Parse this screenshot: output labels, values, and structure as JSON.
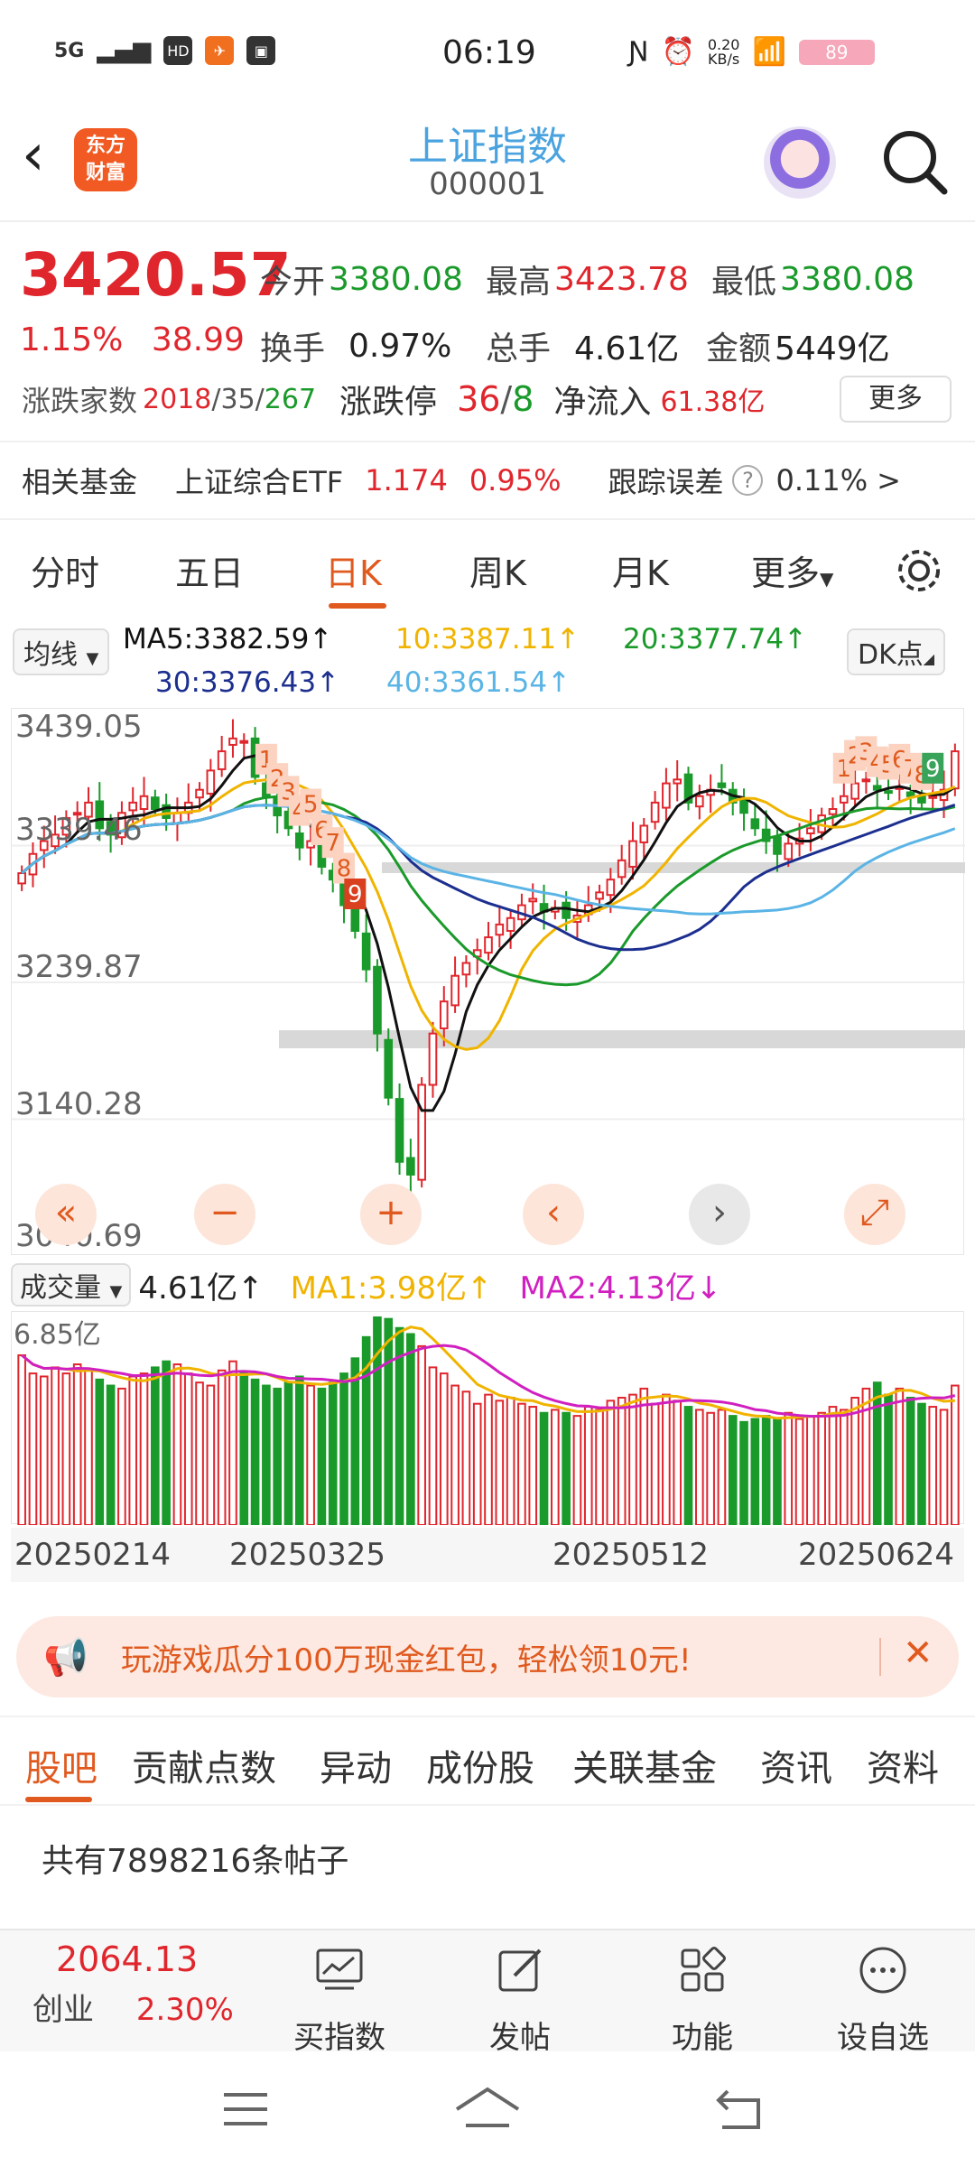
{
  "status_bar": {
    "time": "06:19",
    "network": "5G",
    "net_speed_value": "0.20",
    "net_speed_unit": "KB/s",
    "battery": "89"
  },
  "header": {
    "logo_line1": "东方",
    "logo_line2": "财富",
    "title": "上证指数",
    "code": "000001"
  },
  "quote": {
    "price": "3420.57",
    "change_pct": "1.15%",
    "change_amt": "38.99",
    "open_label": "今开",
    "open": "3380.08",
    "high_label": "最高",
    "high": "3423.78",
    "low_label": "最低",
    "low": "3380.08",
    "turnover_label": "换手",
    "turnover": "0.97%",
    "volume_label": "总手",
    "volume": "4.61亿",
    "amount_label": "金额",
    "amount": "5449亿",
    "breadth_label": "涨跌家数",
    "breadth_up": "2018",
    "breadth_flat": "35",
    "breadth_down": "267",
    "limit_label": "涨跌停",
    "limit_up": "36",
    "limit_down": "8",
    "netflow_label": "净流入",
    "netflow": "61.38亿",
    "more_button": "更多"
  },
  "related_fund": {
    "label": "相关基金",
    "name": "上证综合ETF",
    "price": "1.174",
    "change": "0.95%",
    "tracking_label": "跟踪误差",
    "tracking_value": "0.11%",
    "arrow": ">"
  },
  "tabs": {
    "intraday": "分时",
    "five_day": "五日",
    "daily_k": "日K",
    "weekly_k": "周K",
    "monthly_k": "月K",
    "more": "更多"
  },
  "ma_legend": {
    "selector": "均线",
    "ma5": "MA5:3382.59↑",
    "ma10": "10:3387.11↑",
    "ma20": "20:3377.74↑",
    "ma30": "30:3376.43↑",
    "ma40": "40:3361.54↑",
    "dk_button": "DK点",
    "colors": {
      "ma5": "#111111",
      "ma10": "#f0b400",
      "ma20": "#1a9a2a",
      "ma30": "#1c2f8f",
      "ma40": "#5ab4e5"
    }
  },
  "chart_data": {
    "type": "candlestick",
    "y_axis_labels": [
      "3439.05",
      "3339.46",
      "3239.87",
      "3140.28",
      "3040.69"
    ],
    "ylim": [
      3040.69,
      3439.05
    ],
    "x_axis_labels": [
      "20250214",
      "20250325",
      "20250512",
      "20250624"
    ],
    "annotation_digits": [
      "1",
      "2",
      "3",
      "4",
      "5",
      "6",
      "7",
      "8",
      "9"
    ],
    "volume_selector": "成交量",
    "volume_value": "4.61亿↑",
    "volume_ma1": "MA1:3.98亿↑",
    "volume_ma2": "MA2:4.13亿↓",
    "volume_max_label": "6.85亿",
    "up_color": "#e0262d",
    "down_color": "#1a9a2a",
    "closes": [
      3325,
      3340,
      3350,
      3355,
      3368,
      3372,
      3380,
      3360,
      3355,
      3372,
      3380,
      3385,
      3375,
      3368,
      3372,
      3380,
      3390,
      3405,
      3420,
      3430,
      3428,
      3400,
      3385,
      3370,
      3360,
      3345,
      3350,
      3330,
      3320,
      3300,
      3280,
      3250,
      3200,
      3150,
      3100,
      3090,
      3160,
      3200,
      3225,
      3245,
      3255,
      3265,
      3275,
      3285,
      3290,
      3300,
      3305,
      3295,
      3298,
      3290,
      3292,
      3300,
      3310,
      3320,
      3335,
      3350,
      3362,
      3380,
      3395,
      3398,
      3380,
      3385,
      3390,
      3392,
      3380,
      3372,
      3360,
      3350,
      3340,
      3348,
      3352,
      3360,
      3370,
      3375,
      3385,
      3395,
      3398,
      3390,
      3388,
      3392,
      3385,
      3380,
      3385,
      3390,
      3420
    ],
    "volumes": [
      5.6,
      5.0,
      4.9,
      5.2,
      5.0,
      5.3,
      5.1,
      4.8,
      4.6,
      4.5,
      4.9,
      5.0,
      5.2,
      5.4,
      5.3,
      5.0,
      4.7,
      4.6,
      5.1,
      5.4,
      5.0,
      4.8,
      4.6,
      4.5,
      4.7,
      4.9,
      4.6,
      4.5,
      4.7,
      5.0,
      5.5,
      6.2,
      6.85,
      6.8,
      6.5,
      6.3,
      5.9,
      5.2,
      5.0,
      4.6,
      4.4,
      4.0,
      4.3,
      4.1,
      4.2,
      4.0,
      3.9,
      3.7,
      3.8,
      3.7,
      3.6,
      3.9,
      3.8,
      4.1,
      4.2,
      4.3,
      4.5,
      4.0,
      4.3,
      4.1,
      3.9,
      3.8,
      3.7,
      3.8,
      3.6,
      3.4,
      3.5,
      3.6,
      3.5,
      3.7,
      3.5,
      3.6,
      3.7,
      3.9,
      3.8,
      4.2,
      4.5,
      4.7,
      4.3,
      4.5,
      4.2,
      4.0,
      3.9,
      3.8,
      4.6
    ],
    "zoom_buttons": [
      "«",
      "−",
      "+",
      "‹",
      "›",
      "⤢"
    ]
  },
  "banner": {
    "text": "玩游戏瓜分100万现金红包，轻松领10元!",
    "close": "✕"
  },
  "section_tabs": [
    "股吧",
    "贡献点数",
    "异动",
    "成份股",
    "关联基金",
    "资讯",
    "资料"
  ],
  "posts": {
    "count_text": "共有7898216条帖子"
  },
  "bottom_bar": {
    "index_value": "2064.13",
    "index_name": "创业",
    "index_change": "2.30%",
    "buy_index": "买指数",
    "post": "发帖",
    "functions": "功能",
    "add_watch": "设自选"
  }
}
